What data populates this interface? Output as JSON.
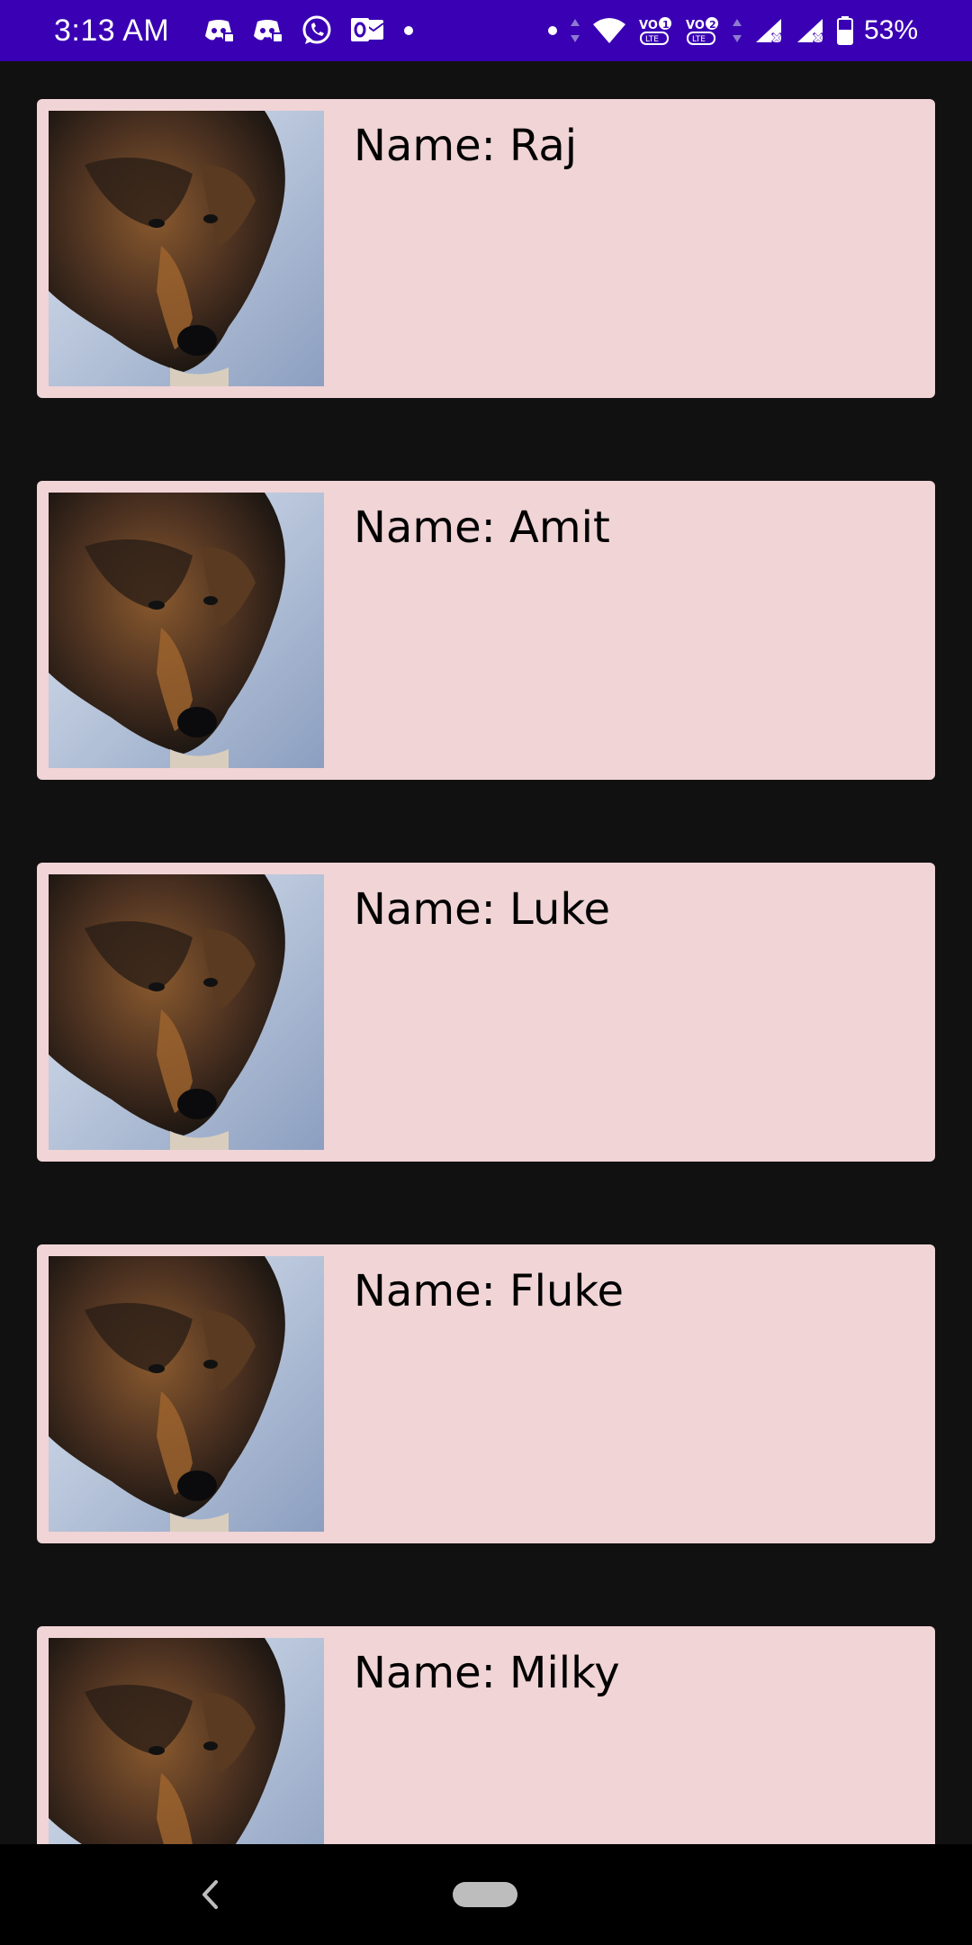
{
  "status_bar": {
    "time": "3:13 AM",
    "battery_percent": "53%",
    "background_color": "#3a00b4",
    "left_icons": [
      "discord-icon",
      "discord-icon",
      "whatsapp-icon",
      "outlook-icon",
      "notification-dot-icon"
    ],
    "right_icons": [
      "notification-dot-icon",
      "data-arrows-icon",
      "wifi-icon",
      "volte1-icon",
      "volte2-icon",
      "data-arrows-icon",
      "signal-icon",
      "signal-icon",
      "battery-icon"
    ]
  },
  "list": {
    "background_color": "#121112",
    "card_color": "#f0d4d6",
    "items": [
      {
        "label": "Name: Raj",
        "image": "dog-photo"
      },
      {
        "label": "Name: Amit",
        "image": "dog-photo"
      },
      {
        "label": "Name: Luke",
        "image": "dog-photo"
      },
      {
        "label": "Name: Fluke",
        "image": "dog-photo"
      },
      {
        "label": "Name: Milky",
        "image": "dog-photo"
      }
    ]
  },
  "nav_bar": {
    "icons": [
      "back-icon",
      "home-pill-icon"
    ]
  }
}
